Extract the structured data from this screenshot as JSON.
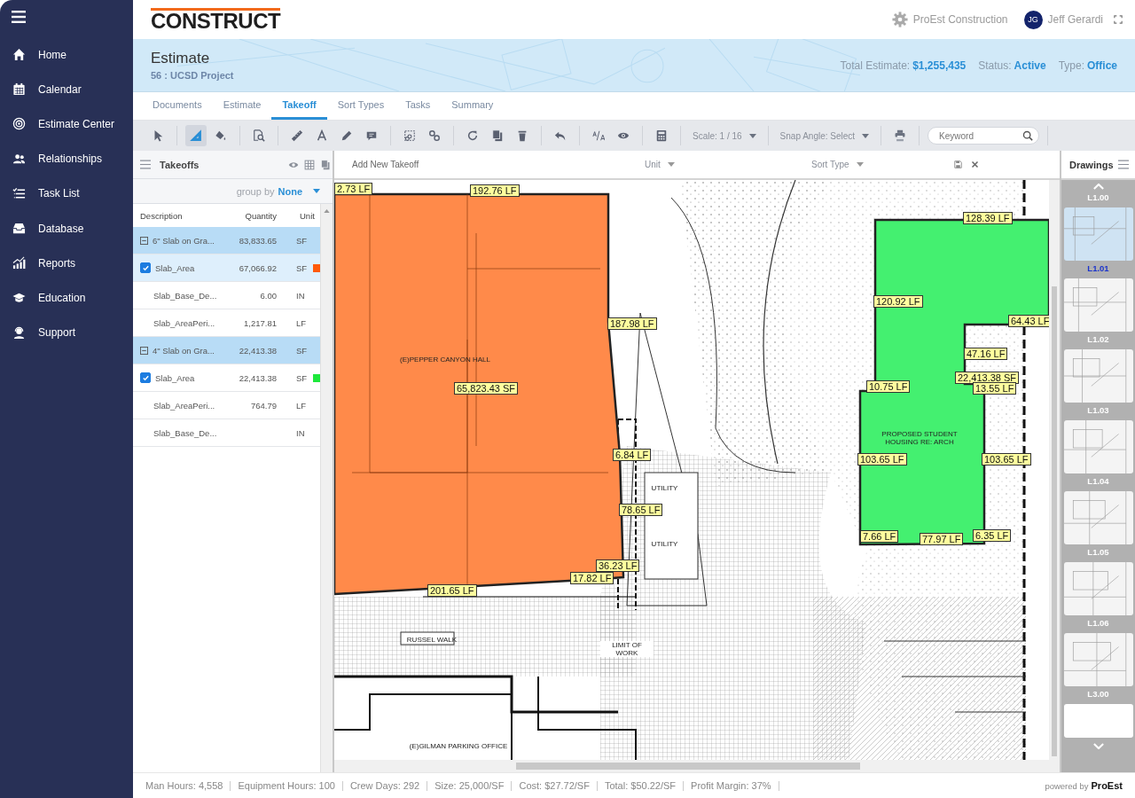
{
  "sidebar": {
    "items": [
      {
        "label": "Home",
        "selected": false
      },
      {
        "label": "Calendar",
        "selected": false
      },
      {
        "label": "Estimate Center",
        "selected": false
      },
      {
        "label": "Relationships",
        "selected": false
      },
      {
        "label": "Task List",
        "selected": false
      },
      {
        "label": "Database",
        "selected": false
      },
      {
        "label": "Reports",
        "selected": false
      },
      {
        "label": "Education",
        "selected": false
      },
      {
        "label": "Support",
        "selected": false
      }
    ]
  },
  "header": {
    "logo": "CONSTRUCT",
    "company": "ProEst Construction",
    "avatar_initials": "JG",
    "user": "Jeff Gerardi"
  },
  "banner": {
    "title": "Estimate",
    "subtitle": "56 : UCSD Project",
    "stats": [
      {
        "label": "Total Estimate:",
        "value": "$1,255,435"
      },
      {
        "label": "Status:",
        "value": "Active"
      },
      {
        "label": "Type:",
        "value": "Office"
      }
    ]
  },
  "tabs": [
    {
      "label": "Documents",
      "selected": false
    },
    {
      "label": "Estimate",
      "selected": false
    },
    {
      "label": "Takeoff",
      "selected": true
    },
    {
      "label": "Sort Types",
      "selected": false
    },
    {
      "label": "Tasks",
      "selected": false
    },
    {
      "label": "Summary",
      "selected": false
    }
  ],
  "toolbar": {
    "tools": [
      {
        "selected": false
      },
      {
        "selected": true
      },
      {
        "selected": false
      },
      {
        "selected": false
      },
      {
        "selected": false
      },
      {
        "selected": false
      },
      {
        "selected": false
      },
      {
        "selected": false
      },
      {
        "selected": false
      },
      {
        "selected": false
      },
      {
        "selected": false
      },
      {
        "selected": false
      },
      {
        "selected": false
      },
      {
        "selected": false
      },
      {
        "selected": false
      },
      {
        "selected": false
      },
      {
        "selected": false
      }
    ],
    "scale": "Scale: 1 / 16",
    "snap_angle": "Snap Angle: Select",
    "search": {
      "placeholder": "Keyword"
    }
  },
  "takeoffs": {
    "title": "Takeoffs",
    "group_by_label": "group by",
    "group_by_value": "None",
    "columns": [
      "Description",
      "Quantity",
      "Unit"
    ],
    "rows": [
      {
        "kind": "group",
        "expanded": true,
        "selected": false,
        "description": "6\" Slab on Gra...",
        "quantity": "83,833.65",
        "unit": "SF"
      },
      {
        "kind": "area",
        "checked": true,
        "selected": true,
        "color": "#ff5a0a",
        "description": "Slab_Area",
        "quantity": "67,066.92",
        "unit": "SF"
      },
      {
        "kind": "item",
        "selected": false,
        "description": "Slab_Base_De...",
        "quantity": "6.00",
        "unit": "IN"
      },
      {
        "kind": "item",
        "selected": false,
        "description": "Slab_AreaPeri...",
        "quantity": "1,217.81",
        "unit": "LF"
      },
      {
        "kind": "group",
        "expanded": true,
        "selected": false,
        "description": "4\" Slab on Gra...",
        "quantity": "22,413.38",
        "unit": "SF"
      },
      {
        "kind": "area",
        "checked": true,
        "selected": false,
        "color": "#1ee83c",
        "description": "Slab_Area",
        "quantity": "22,413.38",
        "unit": "SF"
      },
      {
        "kind": "item",
        "selected": false,
        "description": "Slab_AreaPeri...",
        "quantity": "764.79",
        "unit": "LF"
      },
      {
        "kind": "item",
        "selected": false,
        "description": "Slab_Base_De...",
        "unit": "IN"
      }
    ]
  },
  "canvas": {
    "add_new": "Add New Takeoff",
    "unit_label": "Unit",
    "sort_label": "Sort Type",
    "measurements": [
      "2.73 LF",
      "192.76 LF",
      "187.98 LF",
      "65,823.43 SF",
      "6.84 LF",
      "78.65 LF",
      "36.23 LF",
      "17.82 LF",
      "201.65 LF",
      "128.39 LF",
      "120.92 LF",
      "64.43 LF",
      "47.16 LF",
      "10.75 LF",
      "22,413.38 SF",
      "13.55 LF",
      "103.65 LF",
      "103.65 LF",
      "7.66 LF",
      "77.97 LF",
      "6.35 LF"
    ],
    "plan_labels": [
      "(E)PEPPER CANYON HALL",
      "UTILITY",
      "UTILITY",
      "LIMIT OF WORK",
      "RUSSEL WALK",
      "(E)GILMAN PARKING OFFICE",
      "PROPOSED STUDENT HOUSING RE: ARCH"
    ]
  },
  "drawings": {
    "title": "Drawings",
    "sheets": [
      {
        "label": "L1.00",
        "selected": false
      },
      {
        "label": "L1.01",
        "selected": true
      },
      {
        "label": "L1.02",
        "selected": false
      },
      {
        "label": "L1.03",
        "selected": false
      },
      {
        "label": "L1.04",
        "selected": false
      },
      {
        "label": "L1.05",
        "selected": false
      },
      {
        "label": "L1.06",
        "selected": false
      },
      {
        "label": "L3.00",
        "selected": false
      }
    ]
  },
  "status_bar": {
    "stats": [
      "Man Hours: 4,558",
      "Equipment Hours: 100",
      "Crew Days: 292",
      "Size: 25,000/SF",
      "Cost: $27.72/SF",
      "Total: $50.22/SF",
      "Profit Margin: 37%"
    ],
    "powered_by": "powered by",
    "brand": "ProEst"
  }
}
